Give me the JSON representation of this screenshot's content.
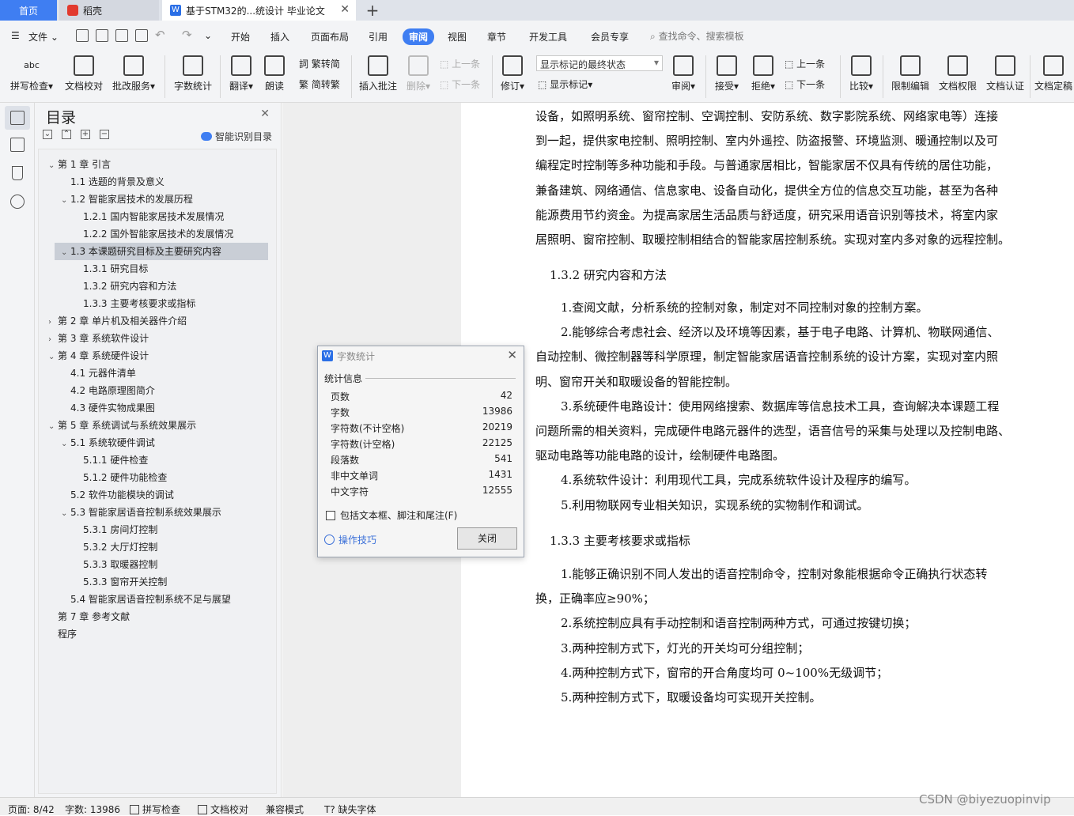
{
  "tabs": {
    "home": "首页",
    "wps": "稻壳",
    "doc": "基于STM32的...统设计 毕业论文"
  },
  "menu": {
    "file": "文件",
    "items": [
      "开始",
      "插入",
      "页面布局",
      "引用",
      "审阅",
      "视图",
      "章节",
      "开发工具",
      "会员专享"
    ],
    "active": "审阅",
    "search": "查找命令、搜索模板"
  },
  "ribbon": {
    "spellcheck": "拼写检查",
    "doc_proof": "文档校对",
    "batch_service": "批改服务",
    "word_count": "字数统计",
    "translate": "翻译",
    "read_aloud": "朗读",
    "trad_conv": "繁转简",
    "simp_conv": "简转繁",
    "insert_comment": "插入批注",
    "delete": "删除",
    "prev": "上一条",
    "next": "下一条",
    "revise": "修订",
    "markup_state": "显示标记的最终状态",
    "show_markup": "显示标记",
    "review": "审阅",
    "accept": "接受",
    "reject": "拒绝",
    "prev2": "上一条",
    "next2": "下一条",
    "compare": "比较",
    "restrict_edit": "限制编辑",
    "doc_rights": "文档权限",
    "doc_cert": "文档认证",
    "doc_final": "文档定稿"
  },
  "toc": {
    "title": "目录",
    "smart": "智能识别目录",
    "items": [
      {
        "text": "第 1 章  引言",
        "level": 0,
        "car": "v"
      },
      {
        "text": "1.1  选题的背景及意义",
        "level": 1,
        "car": ""
      },
      {
        "text": "1.2  智能家居技术的发展历程",
        "level": 1,
        "car": "v"
      },
      {
        "text": "1.2.1  国内智能家居技术发展情况",
        "level": 2,
        "car": ""
      },
      {
        "text": "1.2.2  国外智能家居技术的发展情况",
        "level": 2,
        "car": ""
      },
      {
        "text": "1.3    本课题研究目标及主要研究内容",
        "level": 1,
        "car": "v",
        "selected": true
      },
      {
        "text": "1.3.1  研究目标",
        "level": 2,
        "car": ""
      },
      {
        "text": "1.3.2  研究内容和方法",
        "level": 2,
        "car": ""
      },
      {
        "text": "1.3.3  主要考核要求或指标",
        "level": 2,
        "car": ""
      },
      {
        "text": "第 2 章  单片机及相关器件介绍",
        "level": 0,
        "car": ">"
      },
      {
        "text": "第 3 章  系统软件设计",
        "level": 0,
        "car": ">"
      },
      {
        "text": "第 4 章  系统硬件设计",
        "level": 0,
        "car": "v"
      },
      {
        "text": "4.1  元器件清单",
        "level": 1,
        "car": ""
      },
      {
        "text": "4.2  电路原理图简介",
        "level": 1,
        "car": ""
      },
      {
        "text": "4.3  硬件实物成果图",
        "level": 1,
        "car": ""
      },
      {
        "text": "第 5 章  系统调试与系统效果展示",
        "level": 0,
        "car": "v"
      },
      {
        "text": "5.1  系统软硬件调试",
        "level": 1,
        "car": "v"
      },
      {
        "text": "5.1.1  硬件检查",
        "level": 2,
        "car": ""
      },
      {
        "text": "5.1.2  硬件功能检查",
        "level": 2,
        "car": ""
      },
      {
        "text": "5.2  软件功能模块的调试",
        "level": 1,
        "car": ""
      },
      {
        "text": "5.3  智能家居语音控制系统效果展示",
        "level": 1,
        "car": "v"
      },
      {
        "text": "5.3.1  房间灯控制",
        "level": 2,
        "car": ""
      },
      {
        "text": "5.3.2  大厅灯控制",
        "level": 2,
        "car": ""
      },
      {
        "text": "5.3.3  取暖器控制",
        "level": 2,
        "car": ""
      },
      {
        "text": "5.3.3  窗帘开关控制",
        "level": 2,
        "car": ""
      },
      {
        "text": "5.4  智能家居语音控制系统不足与展望",
        "level": 1,
        "car": ""
      },
      {
        "text": "第 7 章  参考文献",
        "level": 0,
        "car": ""
      },
      {
        "text": "程序",
        "level": 0,
        "car": ""
      }
    ]
  },
  "doc": {
    "p1": [
      "设备，如照明系统、窗帘控制、空调控制、安防系统、数字影院系统、网络家电等）连接",
      "到一起，提供家电控制、照明控制、室内外遥控、防盗报警、环境监测、暖通控制以及可",
      "编程定时控制等多种功能和手段。与普通家居相比，智能家居不仅具有传统的居住功能，",
      "兼备建筑、网络通信、信息家电、设备自动化，提供全方位的信息交互功能，甚至为各种",
      "能源费用节约资金。为提高家居生活品质与舒适度，研究采用语音识别等技术，将室内家",
      "居照明、窗帘控制、取暖控制相结合的智能家居控制系统。实现对室内多对象的远程控制。"
    ],
    "h132": "1.3.2  研究内容和方法",
    "p2": [
      "1.查阅文献，分析系统的控制对象，制定对不同控制对象的控制方案。",
      "2.能够综合考虑社会、经济以及环境等因素，基于电子电路、计算机、物联网通信、",
      "自动控制、微控制器等科学原理，制定智能家居语音控制系统的设计方案，实现对室内照",
      "明、窗帘开关和取暖设备的智能控制。",
      "3.系统硬件电路设计：使用网络搜索、数据库等信息技术工具，查询解决本课题工程",
      "问题所需的相关资料，完成硬件电路元器件的选型，语音信号的采集与处理以及控制电路、",
      "驱动电路等功能电路的设计，绘制硬件电路图。",
      "4.系统软件设计：利用现代工具，完成系统软件设计及程序的编写。",
      "5.利用物联网专业相关知识，实现系统的实物制作和调试。"
    ],
    "h133": "1.3.3  主要考核要求或指标",
    "p3": [
      "1.能够正确识别不同人发出的语音控制命令，控制对象能根据命令正确执行状态转",
      "换，正确率应≥90%；",
      "2.系统控制应具有手动控制和语音控制两种方式，可通过按键切换；",
      "3.两种控制方式下，灯光的开关均可分组控制；",
      "4.两种控制方式下，窗帘的开合角度均可 0~100%无级调节；",
      "5.两种控制方式下，取暖设备均可实现开关控制。"
    ]
  },
  "dialog": {
    "title": "字数统计",
    "section": "统计信息",
    "rows": [
      {
        "label": "页数",
        "value": "42"
      },
      {
        "label": "字数",
        "value": "13986"
      },
      {
        "label": "字符数(不计空格)",
        "value": "20219"
      },
      {
        "label": "字符数(计空格)",
        "value": "22125"
      },
      {
        "label": "段落数",
        "value": "541"
      },
      {
        "label": "非中文单词",
        "value": "1431"
      },
      {
        "label": "中文字符",
        "value": "12555"
      }
    ],
    "checkbox": "包括文本框、脚注和尾注(F)",
    "tips": "操作技巧",
    "close": "关闭"
  },
  "status": {
    "page": "页面: 8/42",
    "words": "字数: 13986",
    "spell": "拼写检查",
    "proof": "文档校对",
    "compat": "兼容模式",
    "missing_font": "缺失字体"
  },
  "watermark": "CSDN @biyezuopinvip",
  "colors": {
    "accent": "#3f7ef2",
    "link": "#3a6fd8"
  }
}
